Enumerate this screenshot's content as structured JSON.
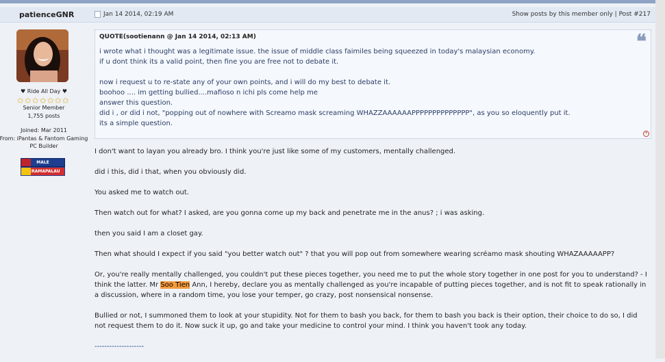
{
  "post": {
    "username": "patienceGNR",
    "date": "Jan 14 2014, 02:19 AM",
    "show_posts": "Show posts by this member only",
    "separator": " | ",
    "post_number": "Post #217"
  },
  "user": {
    "title": "♥ Ride All Day ♥",
    "stars": 7,
    "rank": "Senior Member",
    "posts": "1,755 posts",
    "joined": "Joined: Mar 2011",
    "from": "From: iPantas & Fantom Gaming PC Builder",
    "badge_gender": "MALE",
    "badge_location": "KERAMAPALAU"
  },
  "quote": {
    "header": "QUOTE(sootienann @ Jan 14 2014, 02:13 AM)",
    "lines": [
      "i wrote what i thought was a legitimate issue. the issue of middle class faimiles being squeezed in today's malaysian economy.",
      "if u dont think its a valid point, then fine you are free not to debate it.",
      "",
      "now i request u to re-state any of your own points, and i will do my best to debate it.",
      "boohoo .... im getting bullied....mafioso n ichi pls come help me",
      "answer this question.",
      "did i , or did i not, \"popping out of nowhere with Screamo mask screaming WHAZZAAAAAAPPPPPPPPPPPPPP\", as you so eloquently put it.",
      "its a simple question."
    ]
  },
  "body": {
    "p1": "I don't want to layan you already bro. I think you're just like some of my customers, mentally challenged.",
    "p2": "did i this, did i that, when you obviously did.",
    "p3": "You asked me to watch out.",
    "p4": "Then watch out for what? I asked, are you gonna come up my back and penetrate me in the anus? ; i was asking.",
    "p5": "then you said I am a closet gay.",
    "p6": "Then what should I expect if you said \"you better watch out\" ? that you will pop out from somewhere wearing scréamo mask shouting WHAZAAAAAPP?",
    "p7a": "Or, you're really mentally challenged, you couldn't put these pieces together, you need me to put the whole story together in one post for you to understand? - I think the latter. Mr ",
    "p7_highlight": "Soo Tien",
    "p7b": " Ann, I hereby, declare you as mentally challenged as you're incapable of putting pieces together, and is not fit to speak rationally in a discussion, where in a random time, you lose your temper, go crazy, post nonsensical nonsense.",
    "p8": "Bullied or not, I summoned them to look at your stupidity. Not for them to bash you back, for them to bash you back is their option, their choice to do so, I did not request them to do it. Now suck it up, go and take your medicine to control your mind. I think you haven't took any today.",
    "signature_line": "--------------------"
  },
  "colors": {
    "highlight": "#f59b3d",
    "quote_text": "#2a3d66",
    "header_bg": "#e2e9f3"
  }
}
